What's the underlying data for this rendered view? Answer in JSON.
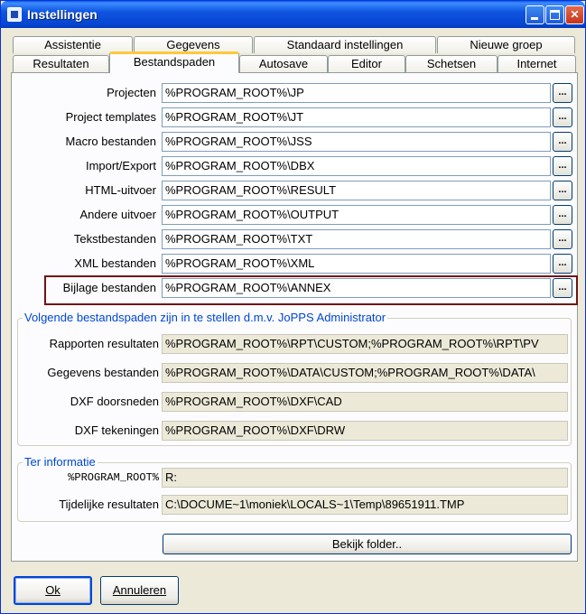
{
  "window": {
    "title": "Instellingen"
  },
  "tabs_row1": [
    "Assistentie",
    "Gegevens",
    "Standaard instellingen",
    "Nieuwe groep"
  ],
  "tabs_row2": [
    "Resultaten",
    "Bestandspaden",
    "Autosave",
    "Editor",
    "Schetsen",
    "Internet"
  ],
  "active_tab": "Bestandspaden",
  "paths": [
    {
      "label": "Projecten",
      "value": "%PROGRAM_ROOT%\\JP",
      "browse": "..."
    },
    {
      "label": "Project templates",
      "value": "%PROGRAM_ROOT%\\JT",
      "browse": "..."
    },
    {
      "label": "Macro bestanden",
      "value": "%PROGRAM_ROOT%\\JSS",
      "browse": "..."
    },
    {
      "label": "Import/Export",
      "value": "%PROGRAM_ROOT%\\DBX",
      "browse": "..."
    },
    {
      "label": "HTML-uitvoer",
      "value": "%PROGRAM_ROOT%\\RESULT",
      "browse": "..."
    },
    {
      "label": "Andere uitvoer",
      "value": "%PROGRAM_ROOT%\\OUTPUT",
      "browse": "..."
    },
    {
      "label": "Tekstbestanden",
      "value": "%PROGRAM_ROOT%\\TXT",
      "browse": "..."
    },
    {
      "label": "XML bestanden",
      "value": "%PROGRAM_ROOT%\\XML",
      "browse": "..."
    },
    {
      "label": "Bijlage bestanden",
      "value": "%PROGRAM_ROOT%\\ANNEX",
      "browse": "..."
    }
  ],
  "admin_group": {
    "legend": "Volgende bestandspaden zijn in te stellen d.m.v. JoPPS Administrator",
    "rows": [
      {
        "label": "Rapporten resultaten",
        "value": "%PROGRAM_ROOT%\\RPT\\CUSTOM;%PROGRAM_ROOT%\\RPT\\PV"
      },
      {
        "label": "Gegevens bestanden",
        "value": "%PROGRAM_ROOT%\\DATA\\CUSTOM;%PROGRAM_ROOT%\\DATA\\"
      },
      {
        "label": "DXF doorsneden",
        "value": "%PROGRAM_ROOT%\\DXF\\CAD"
      },
      {
        "label": "DXF tekeningen",
        "value": "%PROGRAM_ROOT%\\DXF\\DRW"
      }
    ]
  },
  "info_group": {
    "legend": "Ter informatie",
    "rows": [
      {
        "label": "%PROGRAM_ROOT%",
        "value": "R:"
      },
      {
        "label": "Tijdelijke resultaten",
        "value": "C:\\DOCUME~1\\moniek\\LOCALS~1\\Temp\\89651911.TMP"
      }
    ]
  },
  "buttons": {
    "view_folder": "Bekijk folder..",
    "ok": "Ok",
    "cancel": "Annuleren"
  }
}
